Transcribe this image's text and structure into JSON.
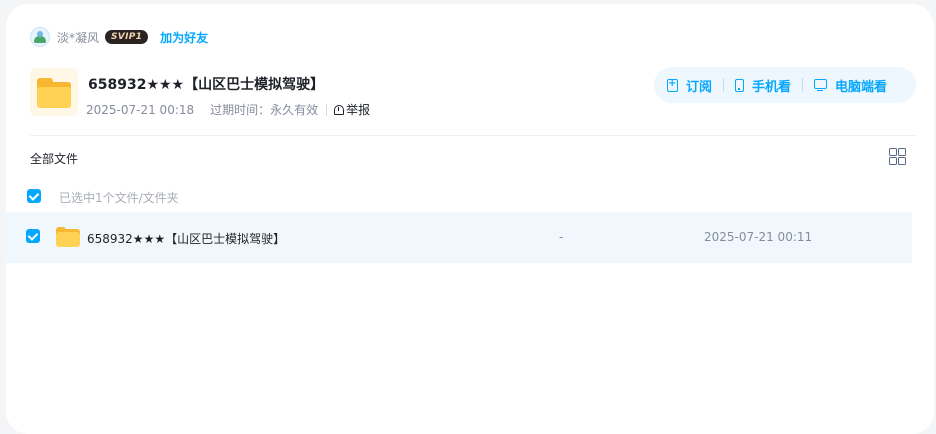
{
  "user": {
    "name": "淡*凝风",
    "badge": "SVIP1",
    "add_friend": "加为好友"
  },
  "share": {
    "title": "658932★★★【山区巴士模拟驾驶】",
    "created": "2025-07-21 00:18",
    "expiry_label": "过期时间：",
    "expiry_value": "永久有效",
    "report": "举报"
  },
  "actions": {
    "subscribe": "订阅",
    "phone": "手机看",
    "pc": "电脑端看"
  },
  "list": {
    "breadcrumb": "全部文件",
    "selected_text": "已选中1个文件/文件夹",
    "rows": [
      {
        "name": "658932★★★【山区巴士模拟驾驶】",
        "size": "-",
        "time": "2025-07-21 00:11",
        "checked": true
      }
    ]
  },
  "colors": {
    "accent": "#06a7ff",
    "row_highlight": "#f0f8fe",
    "folder": "#ffd255"
  }
}
